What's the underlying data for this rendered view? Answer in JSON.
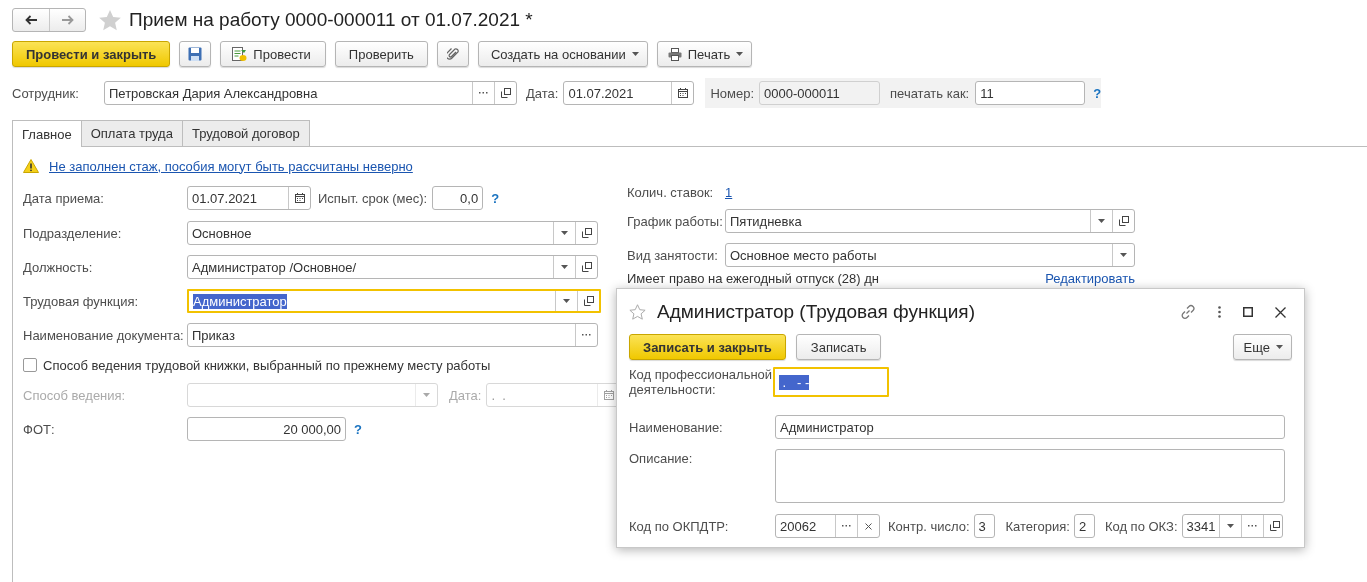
{
  "window": {
    "title": "Прием на работу 0000-000011 от 01.07.2021 *"
  },
  "toolbar": [
    {
      "kind": "primary",
      "label": "Провести и закрыть"
    },
    {
      "kind": "save"
    },
    {
      "kind": "post",
      "label": "Провести"
    },
    {
      "kind": "plain",
      "label": "Проверить"
    },
    {
      "kind": "attach"
    },
    {
      "kind": "menu",
      "label": "Создать на основании"
    },
    {
      "kind": "print",
      "label": "Печать"
    }
  ],
  "header": {
    "employee_label": "Сотрудник:",
    "employee": "Петровская Дария Александровна",
    "date_label": "Дата:",
    "date": "01.07.2021",
    "number_label": "Номер:",
    "number": "0000-000011",
    "print_as_label": "печатать как:",
    "print_as_placeholder": "11",
    "help": "?"
  },
  "tabs": [
    {
      "label": "Главное",
      "selected": true
    },
    {
      "label": "Оплата труда",
      "selected": false
    },
    {
      "label": "Трудовой договор",
      "selected": false
    }
  ],
  "warning": "Не заполнен стаж, пособия могут быть рассчитаны неверно",
  "left": [
    {
      "kind": "date",
      "label": "Дата приема:",
      "value": "01.07.2021",
      "extra_label": "Испыт. срок (мес):",
      "extra_value": "0,0",
      "help": "?"
    },
    {
      "kind": "select",
      "label": "Подразделение:",
      "value": "Основное",
      "focused": false
    },
    {
      "kind": "select",
      "label": "Должность:",
      "value": "Администратор /Основное/",
      "focused": false
    },
    {
      "kind": "select",
      "label": "Трудовая функция:",
      "value": "Администратор",
      "focused": true
    },
    {
      "kind": "choice",
      "label": "Наименование документа:",
      "value": "Приказ"
    },
    {
      "kind": "checkbox",
      "label": "Способ ведения трудовой книжки, выбранный по прежнему месту работы",
      "checked": false
    },
    {
      "kind": "pair",
      "label": "Способ ведения:",
      "date_label": "Дата:",
      "date_placeholder": ".  .",
      "disabled": true
    },
    {
      "kind": "money",
      "label": "ФОТ:",
      "value": "20 000,00",
      "help": "?"
    }
  ],
  "right": {
    "rate_label": "Колич. ставок:",
    "rate": "1",
    "schedule_label": "График работы:",
    "schedule": "Пятидневка",
    "employment_label": "Вид занятости:",
    "employment": "Основное место работы",
    "vacation": "Имеет право на ежегодный отпуск (28) дн",
    "edit_link": "Редактировать"
  },
  "dialog": {
    "title": "Администратор (Трудовая функция)",
    "buttons": [
      {
        "kind": "primary",
        "label": "Записать и закрыть"
      },
      {
        "kind": "plain",
        "label": "Записать"
      }
    ],
    "more": "Еще",
    "code_label": "Код профессиональной деятельности:",
    "code_value": " .   - -",
    "code_focused": true,
    "name_label": "Наименование:",
    "name": "Администратор",
    "desc_label": "Описание:",
    "okpdtr_label": "Код по ОКПДТР:",
    "okpdtr": "20062",
    "check_label": "Контр. число:",
    "check": "3",
    "category_label": "Категория:",
    "category": "2",
    "okz_label": "Код по ОКЗ:",
    "okz": "3341"
  }
}
